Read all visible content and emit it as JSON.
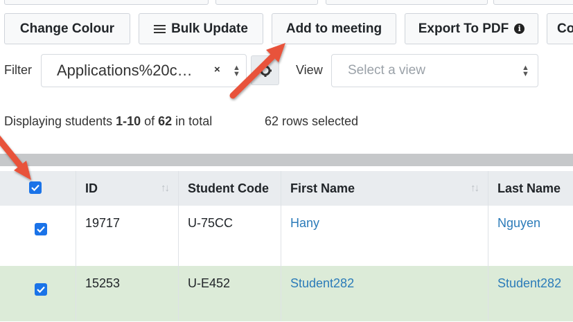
{
  "toolbar": {
    "change_colour": "Change Colour",
    "bulk_update": "Bulk Update",
    "add_to_meeting": "Add to meeting",
    "export_to_pdf": "Export To PDF",
    "info_glyph": "i",
    "clipped_button": "Co"
  },
  "filter": {
    "label": "Filter",
    "value": "Applications%20c…",
    "clear": "×",
    "icons": {
      "clear": "close-icon",
      "updown": "sort-updown-icon",
      "gear": "gear-icon"
    }
  },
  "view": {
    "label": "View",
    "placeholder": "Select a view"
  },
  "status": {
    "prefix": "Displaying students ",
    "range": "1-10",
    "middle": " of ",
    "total": "62",
    "suffix": " in total",
    "selected": "62 rows selected"
  },
  "table": {
    "columns": {
      "id": "ID",
      "student_code": "Student Code",
      "first_name": "First Name",
      "last_name": "Last Name"
    },
    "sort_glyph": "↑↓",
    "header_checkbox_checked": true,
    "rows": [
      {
        "checked": true,
        "id": "19717",
        "student_code": "U-75CC",
        "first_name": "Hany",
        "last_name": "Nguyen",
        "highlight": false
      },
      {
        "checked": true,
        "id": "15253",
        "student_code": "U-E452",
        "first_name": "Student282",
        "last_name": "Student282",
        "highlight": true
      }
    ]
  },
  "colors": {
    "accent": "#1a73e8",
    "link": "#2b7bb9",
    "selected_row": "#dcebd8",
    "arrow": "#e8533a"
  }
}
